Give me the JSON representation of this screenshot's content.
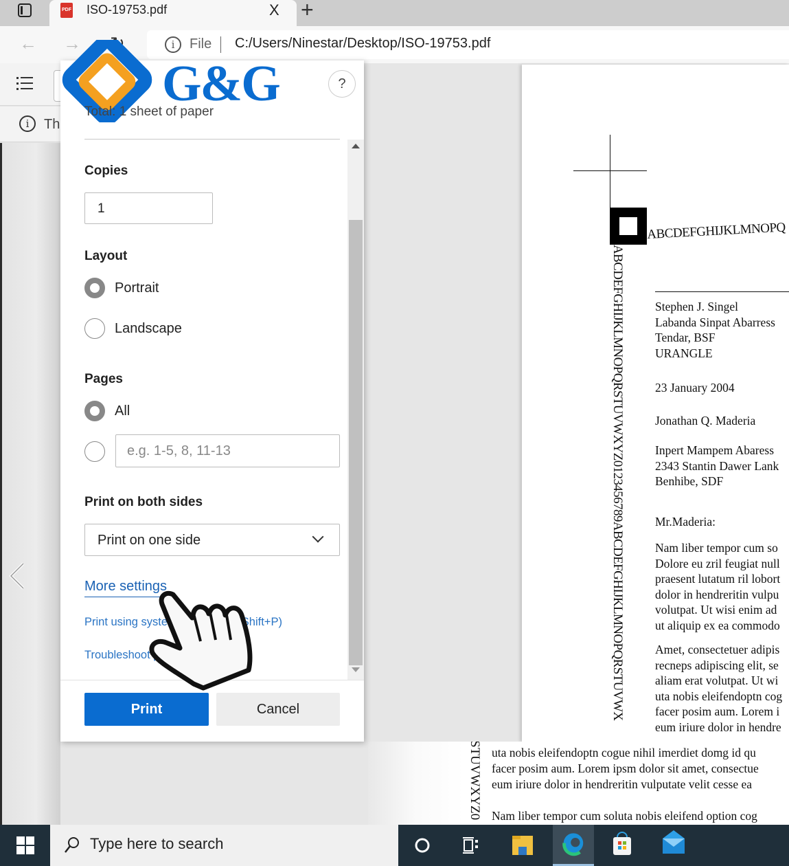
{
  "browser": {
    "tab_title": "ISO-19753.pdf",
    "tab_close": "X",
    "new_tab": "+",
    "address_scheme": "File",
    "address_url": "C:/Users/Ninestar/Desktop/ISO-19753.pdf",
    "infobar_text": "Th",
    "pdf_badge": "PDF"
  },
  "print_dialog": {
    "logo_text": "G&G",
    "help_label": "?",
    "total_text": "Total: 1 sheet of paper",
    "copies_label": "Copies",
    "copies_value": "1",
    "layout_label": "Layout",
    "layout_options": [
      {
        "label": "Portrait",
        "selected": true
      },
      {
        "label": "Landscape",
        "selected": false
      }
    ],
    "pages_label": "Pages",
    "pages_all_label": "All",
    "pages_range_placeholder": "e.g. 1-5, 8, 11-13",
    "duplex_label": "Print on both sides",
    "duplex_value": "Print on one side",
    "more_settings": "More settings",
    "system_dialog_link": "Print using system dialog (Ctrl+Shift+P)",
    "troubleshoot_link": "Troubleshoot printing",
    "print_button": "Print",
    "cancel_button": "Cancel",
    "accent_color": "#0a6cd0"
  },
  "document": {
    "horizontal_strip": "ABCDEFGHIJKLMNOPQ",
    "vertical_strip": "ABCDEFGHIJKLMNOPQRSTUVWXYZ0123456789ABCDEFGHIJKLMNOPQRSTUVWX",
    "sender": [
      "Stephen J. Singel",
      "Labanda Sinpat Abarress",
      "Tendar, BSF",
      "URANGLE"
    ],
    "date": "23 January 2004",
    "recipient_name": "Jonathan Q. Maderia",
    "recipient_address": [
      "Inpert Mampem Abaress",
      "2343 Stantin Dawer Lank",
      "Benhibe, SDF"
    ],
    "salutation": "Mr.Maderia:",
    "paragraph1": [
      "Nam liber tempor cum so",
      "Dolore eu zril feugiat null",
      "praesent lutatum ril lobort",
      "dolor in hendreritin vulpu",
      "volutpat. Ut wisi enim ad",
      "ut aliquip ex ea commodo"
    ],
    "paragraph2": [
      "Amet, consectetuer adipis",
      "recneps adipiscing elit, se",
      "aliam erat volutpat. Ut wi",
      "uta nobis eleifendoptn cog",
      "facer posim aum. Lorem i",
      "eum iriure dolor in hendre"
    ],
    "page2_vertical": "STUVWXYZ0",
    "page2_lines": [
      "uta nobis eleifendoptn cogue nihil imerdiet domg id qu",
      "facer posim aum. Lorem ipsm dolor sit amet, consectue",
      "eum iriure dolor in hendreritin vulputate velit cesse ea",
      "",
      "Nam liber tempor cum soluta nobis eleifend option cog"
    ]
  },
  "taskbar": {
    "search_placeholder": "Type here to search",
    "apps": [
      "cortana",
      "task-view",
      "file-explorer",
      "edge",
      "microsoft-store",
      "mail"
    ]
  }
}
